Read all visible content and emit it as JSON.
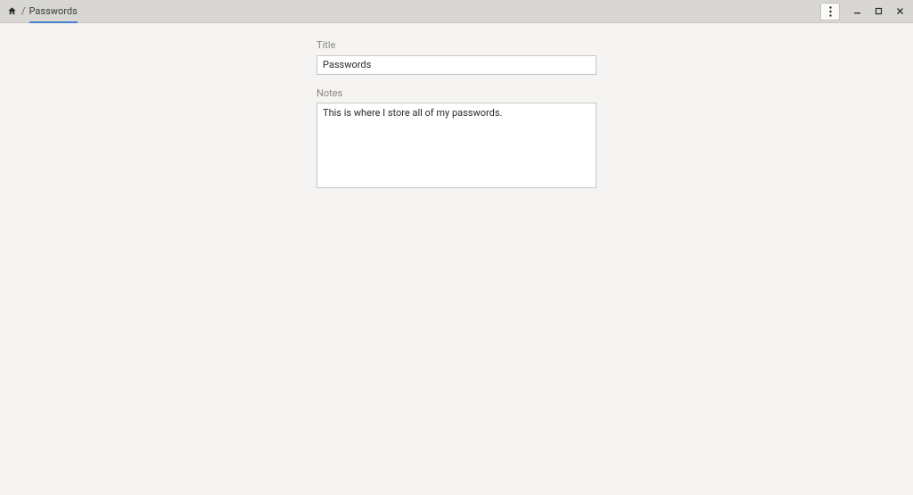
{
  "titlebar": {
    "breadcrumb_separator": "/",
    "breadcrumb_current": "Passwords"
  },
  "form": {
    "title_label": "Title",
    "title_value": "Passwords",
    "notes_label": "Notes",
    "notes_value": "This is where I store all of my passwords."
  }
}
